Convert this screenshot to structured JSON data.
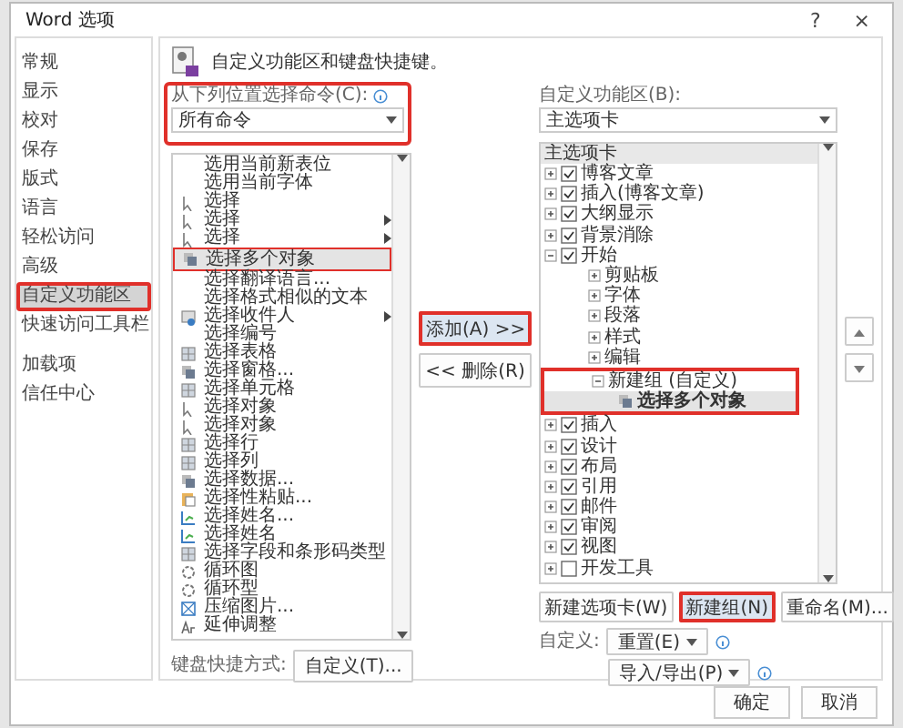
{
  "window": {
    "title": "Word 选项",
    "help": "?",
    "close": "×"
  },
  "sidebar": {
    "items": [
      {
        "label": "常规",
        "selected": false,
        "annotated": false
      },
      {
        "label": "显示",
        "selected": false,
        "annotated": false
      },
      {
        "label": "校对",
        "selected": false,
        "annotated": false
      },
      {
        "label": "保存",
        "selected": false,
        "annotated": false
      },
      {
        "label": "版式",
        "selected": false,
        "annotated": false
      },
      {
        "label": "语言",
        "selected": false,
        "annotated": false
      },
      {
        "label": "轻松访问",
        "selected": false,
        "annotated": false
      },
      {
        "label": "高级",
        "selected": false,
        "annotated": false
      },
      {
        "label": "自定义功能区",
        "selected": true,
        "annotated": true
      },
      {
        "label": "快速访问工具栏",
        "selected": false,
        "annotated": false
      },
      {
        "label": "加载项",
        "selected": false,
        "annotated": false
      },
      {
        "label": "信任中心",
        "selected": false,
        "annotated": false
      }
    ]
  },
  "header": "自定义功能区和键盘快捷键。",
  "commands": {
    "label": "从下列位置选择命令(C):",
    "dropdown": {
      "value": "所有命令",
      "annotated": true
    },
    "items": [
      {
        "text": "选用当前新表位",
        "kind": "text",
        "selected": false,
        "annotated": false,
        "submenu": false
      },
      {
        "text": "选用当前字体",
        "kind": "text",
        "selected": false,
        "annotated": false,
        "submenu": false
      },
      {
        "text": "选择",
        "kind": "cursor",
        "selected": false,
        "annotated": false,
        "submenu": false
      },
      {
        "text": "选择",
        "kind": "cursor",
        "selected": false,
        "annotated": false,
        "submenu": true
      },
      {
        "text": "选择",
        "kind": "cursor",
        "selected": false,
        "annotated": false,
        "submenu": true
      },
      {
        "text": "选择多个对象",
        "kind": "objects",
        "selected": true,
        "annotated": true,
        "submenu": false
      },
      {
        "text": "选择翻译语言...",
        "kind": "text",
        "selected": false,
        "annotated": false,
        "submenu": false
      },
      {
        "text": "选择格式相似的文本",
        "kind": "text",
        "selected": false,
        "annotated": false,
        "submenu": false
      },
      {
        "text": "选择收件人",
        "kind": "person",
        "selected": false,
        "annotated": false,
        "submenu": true
      },
      {
        "text": "选择编号",
        "kind": "text",
        "selected": false,
        "annotated": false,
        "submenu": false
      },
      {
        "text": "选择表格",
        "kind": "grid",
        "selected": false,
        "annotated": false,
        "submenu": false
      },
      {
        "text": "选择窗格...",
        "kind": "objects",
        "selected": false,
        "annotated": false,
        "submenu": false
      },
      {
        "text": "选择单元格",
        "kind": "grid",
        "selected": false,
        "annotated": false,
        "submenu": false
      },
      {
        "text": "选择对象",
        "kind": "cursor",
        "selected": false,
        "annotated": false,
        "submenu": false
      },
      {
        "text": "选择对象",
        "kind": "cursor",
        "selected": false,
        "annotated": false,
        "submenu": false
      },
      {
        "text": "选择行",
        "kind": "grid",
        "selected": false,
        "annotated": false,
        "submenu": false
      },
      {
        "text": "选择列",
        "kind": "grid",
        "selected": false,
        "annotated": false,
        "submenu": false
      },
      {
        "text": "选择数据...",
        "kind": "objects",
        "selected": false,
        "annotated": false,
        "submenu": false
      },
      {
        "text": "选择性粘贴...",
        "kind": "paste",
        "selected": false,
        "annotated": false,
        "submenu": false
      },
      {
        "text": "选择姓名...",
        "kind": "chart",
        "selected": false,
        "annotated": false,
        "submenu": false
      },
      {
        "text": "选择姓名",
        "kind": "chart",
        "selected": false,
        "annotated": false,
        "submenu": false
      },
      {
        "text": "选择字段和条形码类型",
        "kind": "grid",
        "selected": false,
        "annotated": false,
        "submenu": false
      },
      {
        "text": "循环图",
        "kind": "cycle",
        "selected": false,
        "annotated": false,
        "submenu": false
      },
      {
        "text": "循环型",
        "kind": "cycle",
        "selected": false,
        "annotated": false,
        "submenu": false
      },
      {
        "text": "压缩图片...",
        "kind": "compress",
        "selected": false,
        "annotated": false,
        "submenu": false
      },
      {
        "text": "延伸调整",
        "kind": "text-icon",
        "selected": false,
        "annotated": false,
        "submenu": false
      }
    ]
  },
  "shortcuts": {
    "label": "键盘快捷方式:",
    "button": "自定义(T)..."
  },
  "actions": [
    {
      "label": "添加(A) >>",
      "annotated": true
    },
    {
      "label": "<< 删除(R)",
      "annotated": false
    }
  ],
  "ribbon": {
    "label": "自定义功能区(B):",
    "dropdown": {
      "value": "主选项卡"
    },
    "tree_header": "主选项卡",
    "tree": [
      {
        "kind": "tab",
        "label": "博客文章",
        "checked": true,
        "expanded": false
      },
      {
        "kind": "tab",
        "label": "插入(博客文章)",
        "checked": true,
        "expanded": false
      },
      {
        "kind": "tab",
        "label": "大纲显示",
        "checked": true,
        "expanded": false
      },
      {
        "kind": "tab",
        "label": "背景消除",
        "checked": true,
        "expanded": false
      },
      {
        "kind": "tab",
        "label": "开始",
        "checked": true,
        "expanded": true,
        "children": [
          {
            "kind": "group",
            "label": "剪贴板",
            "expanded": false
          },
          {
            "kind": "group",
            "label": "字体",
            "expanded": false
          },
          {
            "kind": "group",
            "label": "段落",
            "expanded": false
          },
          {
            "kind": "group",
            "label": "样式",
            "expanded": false
          },
          {
            "kind": "group",
            "label": "编辑",
            "expanded": false
          },
          {
            "kind": "group",
            "label": "新建组 (自定义)",
            "expanded": true,
            "annotated": true,
            "children": [
              {
                "kind": "command",
                "label": "选择多个对象",
                "selected": true
              }
            ]
          }
        ]
      },
      {
        "kind": "tab",
        "label": "插入",
        "checked": true,
        "expanded": false
      },
      {
        "kind": "tab",
        "label": "设计",
        "checked": true,
        "expanded": false
      },
      {
        "kind": "tab",
        "label": "布局",
        "checked": true,
        "expanded": false
      },
      {
        "kind": "tab",
        "label": "引用",
        "checked": true,
        "expanded": false
      },
      {
        "kind": "tab",
        "label": "邮件",
        "checked": true,
        "expanded": false
      },
      {
        "kind": "tab",
        "label": "审阅",
        "checked": true,
        "expanded": false
      },
      {
        "kind": "tab",
        "label": "视图",
        "checked": true,
        "expanded": false
      },
      {
        "kind": "tab",
        "label": "开发工具",
        "checked": false,
        "expanded": false
      }
    ],
    "buttons": [
      {
        "label": "新建选项卡(W)",
        "annotated": false
      },
      {
        "label": "新建组(N)",
        "annotated": true
      },
      {
        "label": "重命名(M)..."
      }
    ],
    "customize_label": "自定义:",
    "reset": "重置(E)",
    "import_export": "导入/导出(P)"
  },
  "footer": {
    "ok": "确定",
    "cancel": "取消"
  }
}
